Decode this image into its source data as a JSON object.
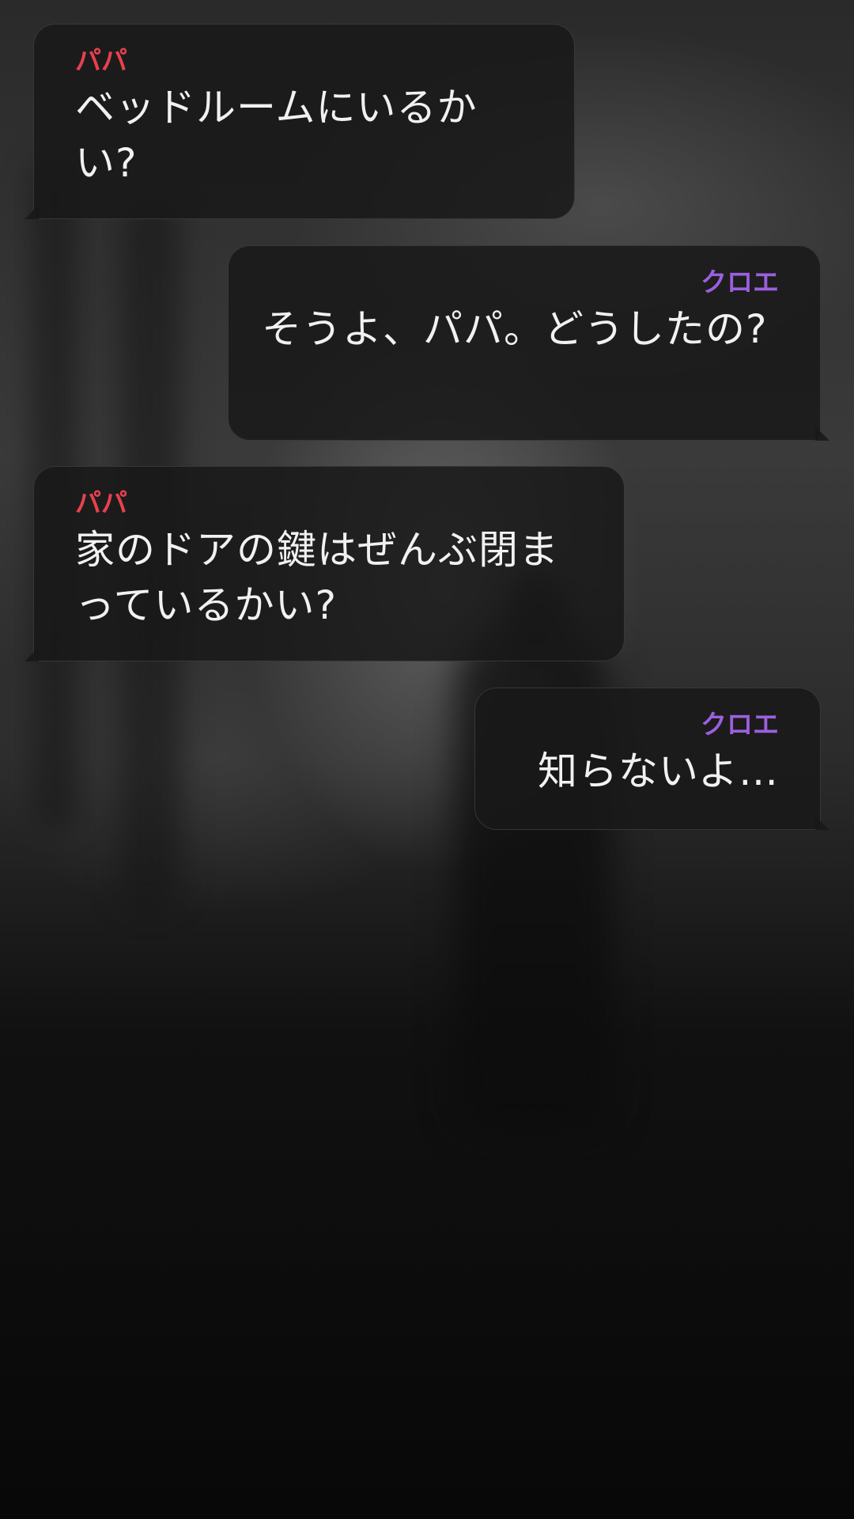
{
  "colors": {
    "papa_name": "#e8414d",
    "chloe_name": "#9c5fe0",
    "bubble_bg": "#181818",
    "message_text": "#f1f1f1"
  },
  "messages": [
    {
      "sender": "パパ",
      "text": "ベッドルームにいるかい?",
      "side": "left"
    },
    {
      "sender": "クロエ",
      "text": "そうよ、パパ。どうしたの?",
      "side": "right"
    },
    {
      "sender": "パパ",
      "text": "家のドアの鍵はぜんぶ閉まっているかい?",
      "side": "left"
    },
    {
      "sender": "クロエ",
      "text": "知らないよ…",
      "side": "right"
    }
  ]
}
